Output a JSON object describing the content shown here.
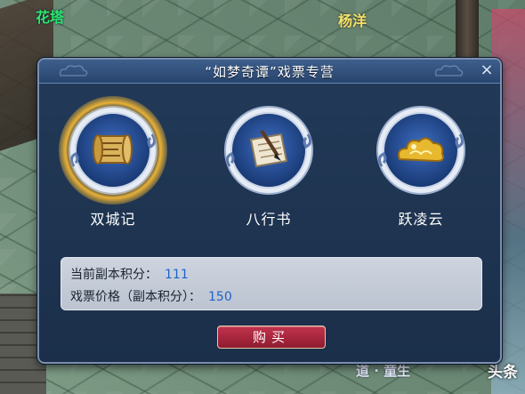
{
  "scene": {
    "texts": [
      "花塔",
      "杨洋",
      "道 · 童生"
    ],
    "watermark": "头条"
  },
  "dialog": {
    "title": "“如梦奇谭”戏票专营",
    "close_glyph": "×",
    "items": [
      {
        "label": "双城记",
        "icon": "scroll-map-icon",
        "selected": true
      },
      {
        "label": "八行书",
        "icon": "letter-brush-icon",
        "selected": false
      },
      {
        "label": "跃凌云",
        "icon": "golden-cloud-icon",
        "selected": false
      }
    ],
    "info": {
      "current_points_label": "当前副本积分：",
      "current_points_value": "111",
      "price_label": "戏票价格（副本积分）：",
      "price_value": "150"
    },
    "buy_label": "购买"
  },
  "colors": {
    "dialog_bg": "#1b2f4a",
    "header_bg": "#3e5f8c",
    "panel_bg": "#c6cdd9",
    "value_blue": "#1f63c9",
    "buy_red": "#b02a42",
    "selection_glow": "#ffbe32"
  }
}
